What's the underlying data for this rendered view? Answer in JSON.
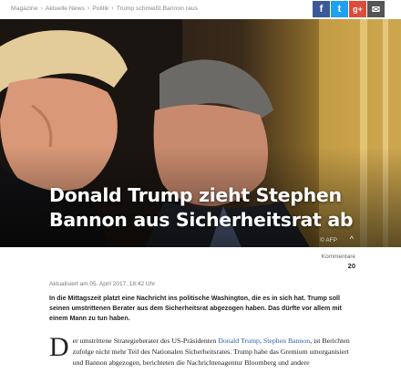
{
  "breadcrumb": [
    "Magazine",
    "Aktuelle News",
    "Politik",
    "Trump schmeißt Bannon raus"
  ],
  "breadcrumb_sep": "›",
  "share": {
    "facebook": "f",
    "twitter": "t",
    "googleplus": "g+",
    "mail": "✉"
  },
  "hero": {
    "title": "Donald Trump zieht Stephen Bannon aus Sicherheitsrat ab",
    "credit": "© AFP",
    "chevron": "^"
  },
  "comments": {
    "label": "Kommentare",
    "count": "20"
  },
  "updated": "Aktualisiert am 05. April 2017, 18:42 Uhr",
  "lead": "In die Mittagszeit platzt eine Nachricht ins politische Washington, die es in sich hat. Trump soll seinen umstrittenen Berater aus dem Sicherheitsrat abgezogen haben. Das dürfte vor allem mit einem Mann zu tun haben.",
  "body": {
    "dropcap": "D",
    "p1_a": "er umstrittene Strategieberater des US-Präsidenten ",
    "link1": "Donald Trump",
    "p1_b": ", ",
    "link2": "Stephen Bannon",
    "p1_c": ", ist Berichten zufolge nicht mehr Teil des Nationalen Sicherheitsrates. Trump habe das Gremium umorganisiert und Bannon abgezogen, berichteten die Nachrichtenagentur Bloomberg und andere"
  },
  "colors": {
    "facebook": "#3b5998",
    "twitter": "#1da1f2",
    "googleplus": "#dd4b39",
    "link": "#2a5db0"
  }
}
